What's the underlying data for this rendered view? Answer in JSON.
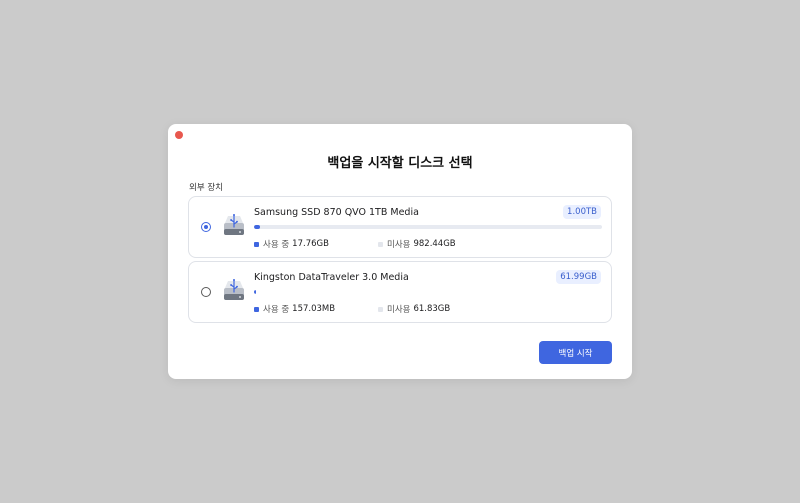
{
  "dialog": {
    "title": "백업을 시작할 디스크 선택",
    "section_label": "외부 장치",
    "start_button": "백업 시작"
  },
  "disks": [
    {
      "name": "Samsung SSD 870 QVO 1TB Media",
      "capacity": "1.00TB",
      "used_label": "사용 중",
      "used": "17.76GB",
      "free_label": "미사용",
      "free": "982.44GB",
      "used_fraction": 0.018,
      "selected": true
    },
    {
      "name": "Kingston DataTraveler 3.0 Media",
      "capacity": "61.99GB",
      "used_label": "사용 중",
      "used": "157.03MB",
      "free_label": "미사용",
      "free": "61.83GB",
      "used_fraction": 0.0025,
      "selected": false
    }
  ],
  "colors": {
    "accent": "#3f66e0",
    "close": "#e8584e",
    "background": "#cbcbcb"
  },
  "icons": {
    "disk": "usb-drive-icon",
    "close": "close-dot-icon"
  }
}
